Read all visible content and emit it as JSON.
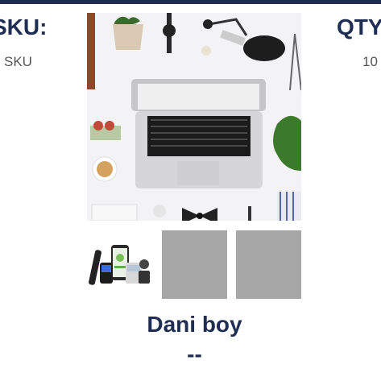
{
  "sku": {
    "label": "SKU:",
    "value": "SKU"
  },
  "qty": {
    "label": "QTY",
    "value": "10"
  },
  "product": {
    "name": "Dani boy",
    "price": "--"
  },
  "colors": {
    "navy": "#1f2d52",
    "placeholder_gray": "#a6a6a6"
  },
  "gallery": {
    "main_image": "desk-flatlay-laptop-photo",
    "thumbnails": [
      "device-bundle-photo",
      "placeholder",
      "placeholder"
    ]
  }
}
